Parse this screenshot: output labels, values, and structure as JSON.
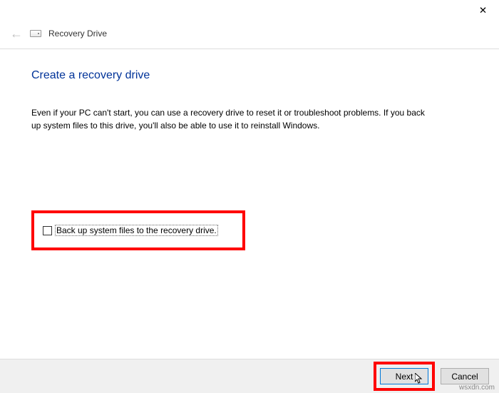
{
  "titlebar": {
    "close": "✕"
  },
  "header": {
    "title": "Recovery Drive"
  },
  "main": {
    "heading": "Create a recovery drive",
    "description": "Even if your PC can't start, you can use a recovery drive to reset it or troubleshoot problems. If you back up system files to this drive, you'll also be able to use it to reinstall Windows.",
    "checkbox_label": "Back up system files to the recovery drive."
  },
  "footer": {
    "next": "Next",
    "cancel": "Cancel"
  },
  "watermark": "wsxdn.com"
}
